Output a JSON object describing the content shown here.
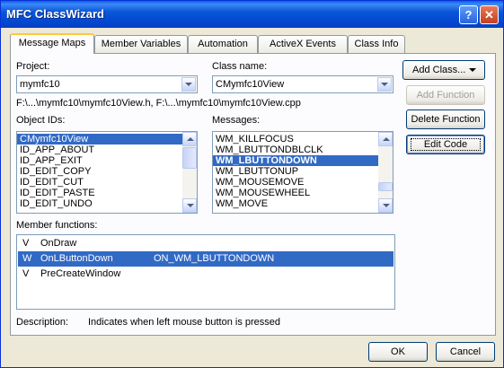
{
  "window": {
    "title": "MFC ClassWizard",
    "help_label": "?",
    "close_label": "✕"
  },
  "tabs": [
    {
      "label": "Message Maps",
      "active": true
    },
    {
      "label": "Member Variables",
      "active": false
    },
    {
      "label": "Automation",
      "active": false
    },
    {
      "label": "ActiveX Events",
      "active": false
    },
    {
      "label": "Class Info",
      "active": false
    }
  ],
  "project": {
    "label": "Project:",
    "value": "mymfc10"
  },
  "class_name": {
    "label": "Class name:",
    "value": "CMymfc10View"
  },
  "file_path": "F:\\...\\mymfc10\\mymfc10View.h, F:\\...\\mymfc10\\mymfc10View.cpp",
  "object_ids": {
    "label": "Object IDs:",
    "items": [
      "CMymfc10View",
      "ID_APP_ABOUT",
      "ID_APP_EXIT",
      "ID_EDIT_COPY",
      "ID_EDIT_CUT",
      "ID_EDIT_PASTE",
      "ID_EDIT_UNDO"
    ],
    "selected_index": 0
  },
  "messages": {
    "label": "Messages:",
    "items": [
      "WM_KILLFOCUS",
      "WM_LBUTTONDBLCLK",
      "WM_LBUTTONDOWN",
      "WM_LBUTTONUP",
      "WM_MOUSEMOVE",
      "WM_MOUSEWHEEL",
      "WM_MOVE"
    ],
    "selected_index": 2
  },
  "member_functions": {
    "label": "Member functions:",
    "rows": [
      {
        "type": "V",
        "name": "OnDraw",
        "handler": ""
      },
      {
        "type": "W",
        "name": "OnLButtonDown",
        "handler": "ON_WM_LBUTTONDOWN"
      },
      {
        "type": "V",
        "name": "PreCreateWindow",
        "handler": ""
      }
    ],
    "selected_index": 1
  },
  "description": {
    "label": "Description:",
    "text": "Indicates when left mouse button is pressed"
  },
  "buttons": {
    "add_class": "Add Class...",
    "add_function": "Add Function",
    "delete_function": "Delete Function",
    "edit_code": "Edit Code",
    "ok": "OK",
    "cancel": "Cancel"
  },
  "icons": {
    "combo_arrow": "chevron-down-icon",
    "scroll_up": "arrow-up-icon",
    "scroll_down": "arrow-down-icon"
  },
  "colors": {
    "title_bar": "#0a57d8",
    "selection": "#316ac5",
    "dialog_bg": "#ece9d8"
  }
}
